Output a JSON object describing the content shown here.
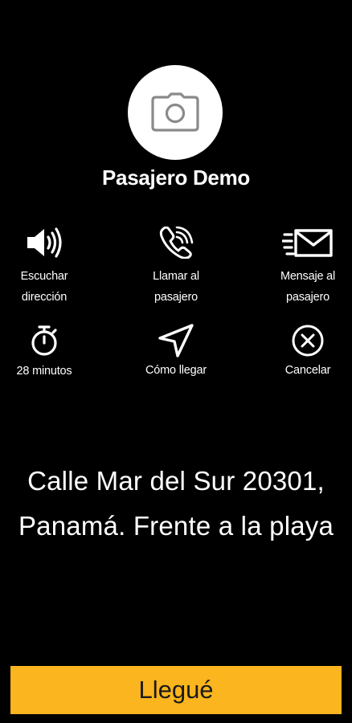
{
  "passenger": {
    "name": "Pasajero Demo",
    "avatar_icon": "camera-icon"
  },
  "actions": [
    {
      "id": "listen-address",
      "icon": "speaker-icon",
      "label": "Escuchar\ndirección"
    },
    {
      "id": "call-passenger",
      "icon": "phone-ringing-icon",
      "label": "Llamar al\npasajero"
    },
    {
      "id": "message-passenger",
      "icon": "envelope-fast-icon",
      "label": "Mensaje al\npasajero"
    },
    {
      "id": "eta",
      "icon": "stopwatch-icon",
      "label": "28 minutos"
    },
    {
      "id": "directions",
      "icon": "navigation-arrow-icon",
      "label": "Cómo llegar"
    },
    {
      "id": "cancel",
      "icon": "close-circle-icon",
      "label": "Cancelar"
    }
  ],
  "address": "Calle Mar del Sur 20301, Panamá. Frente a la playa",
  "arrive_button": {
    "label": "Llegué",
    "color": "#fbb51e"
  },
  "colors": {
    "background": "#000000",
    "text": "#ffffff",
    "avatar_bg": "#ffffff",
    "avatar_icon": "#8a8a8a"
  }
}
